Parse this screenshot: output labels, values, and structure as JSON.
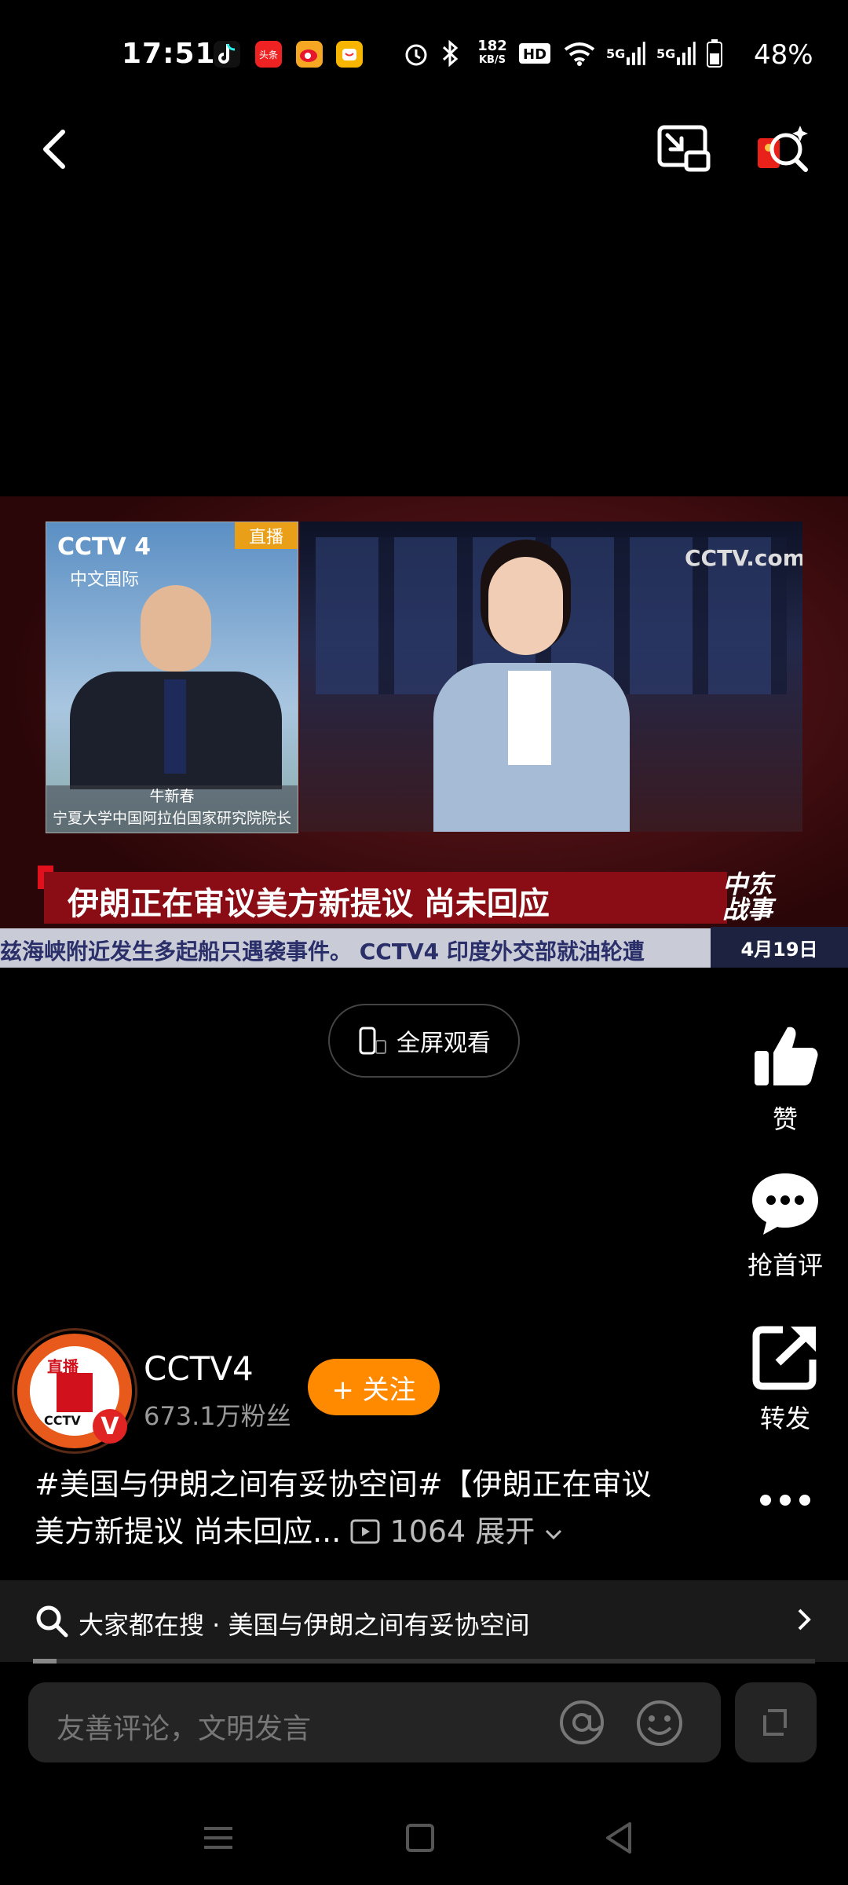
{
  "status_bar": {
    "time": "17:51",
    "network_speed": "182",
    "network_unit": "KB/S",
    "signal": [
      "5G",
      "5G"
    ],
    "battery": "48%",
    "apps": [
      "tiktok-icon",
      "toutiao-icon",
      "weibo-icon",
      "app-icon"
    ],
    "toutiao_label": "头条"
  },
  "video": {
    "inset_channel": "CCTV 4",
    "inset_channel_sub": "中文国际",
    "live_tag": "直播",
    "guest_name": "牛新春",
    "guest_title": "宁夏大学中国阿拉伯国家研究院院长",
    "studio_logo": "CCTV.com",
    "headline": "伊朗正在审议美方新提议 尚未回应",
    "corner_tag_line1": "中东",
    "corner_tag_line2": "战事",
    "ticker": "兹海峡附近发生多起船只遇袭事件。   CCTV4   印度外交部就油轮遭",
    "date": "4月19日"
  },
  "fullscreen_label": "全屏观看",
  "actions": {
    "like": "赞",
    "comment": "抢首评",
    "share": "转发"
  },
  "author": {
    "avatar_live": "直播",
    "avatar_cctv": "CCTV",
    "verified": "V",
    "name": "CCTV4",
    "fans": "673.1万粉丝",
    "follow_label": "+ 关注"
  },
  "caption": {
    "text": "#美国与伊朗之间有妥协空间#【伊朗正在审议美方新提议 尚未回应...",
    "play_count": "1064",
    "expand_label": "展开"
  },
  "search": {
    "text": "大家都在搜 · 美国与伊朗之间有妥协空间"
  },
  "progress": 0.03,
  "comment_input": {
    "placeholder": "友善评论，文明发言"
  }
}
